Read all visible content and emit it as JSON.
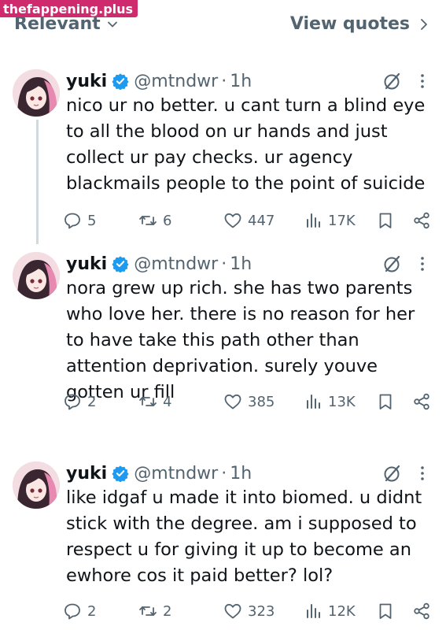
{
  "watermark": "thefappening.plus",
  "header": {
    "sort_label": "Relevant",
    "view_quotes_label": "View quotes"
  },
  "colors": {
    "accent": "#1d9bf0",
    "secondary_text": "#536471",
    "watermark_bg": "#cf2a6d"
  },
  "tweets": [
    {
      "name": "yuki",
      "handle": "@mtndwr",
      "separator": "·",
      "time": "1h",
      "text": "nico ur no better. u cant turn a blind eye\nto all the blood on ur hands and just\ncollect ur pay checks. ur agency\nblackmails people to the point of suicide",
      "replies": "5",
      "reposts": "6",
      "likes": "447",
      "views": "17K"
    },
    {
      "name": "yuki",
      "handle": "@mtndwr",
      "separator": "·",
      "time": "1h",
      "text": "nora grew up rich. she has two parents\nwho love her. there is no reason for her\nto have take this path other than\nattention deprivation. surely youve\ngotten ur fill",
      "replies": "2",
      "reposts": "4",
      "likes": "385",
      "views": "13K"
    },
    {
      "name": "yuki",
      "handle": "@mtndwr",
      "separator": "·",
      "time": "1h",
      "text": "like idgaf u made it into biomed. u didnt\nstick with the degree. am i supposed to\nrespect u for giving it up to become an\newhore cos it paid better? lol?",
      "replies": "2",
      "reposts": "2",
      "likes": "323",
      "views": "12K"
    }
  ],
  "icons": {
    "verified": "verified-badge-icon",
    "grok": "grok-icon",
    "more": "more-options-icon",
    "reply": "reply-icon",
    "repost": "repost-icon",
    "like": "heart-icon",
    "views": "views-icon",
    "bookmark": "bookmark-icon",
    "share": "share-icon"
  }
}
